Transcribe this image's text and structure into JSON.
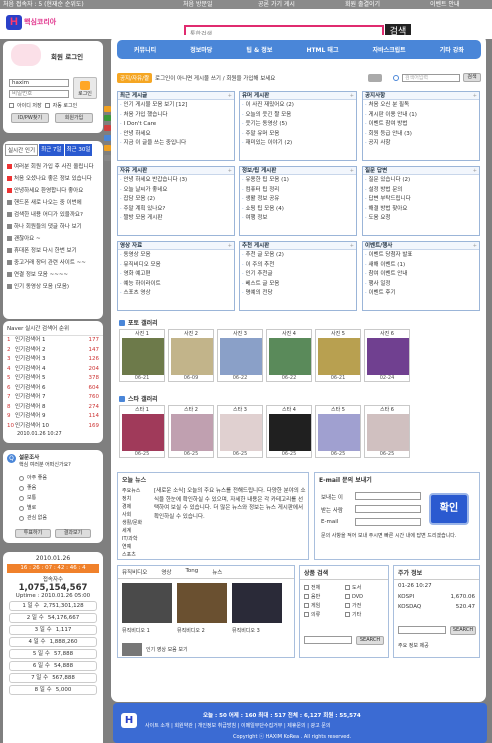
{
  "topbar": {
    "items": [
      "처음 접속자 : 5 (현재순 순위도)",
      "처음 방문일",
      "공론 가기 게시",
      "회원 출결이기",
      "이벤트 안내"
    ]
  },
  "header": {
    "logo": "핵심코리아",
    "search_placeholder": "통합검색",
    "search_button": "검색"
  },
  "login": {
    "title": "회원 로그인",
    "id_value": "haxim",
    "pw_placeholder": "비밀번호",
    "login_button": "로그인",
    "remember_id": "아이디 저장",
    "auto_login": "자동 로그인",
    "find_button": "ID/PW찾기",
    "join_button": "회원가입"
  },
  "ranking": {
    "tabs": [
      "실시간 인기",
      "최근 7일",
      "최근 30일"
    ],
    "items": [
      "여러분 회원 가입 후 사진 올립니다",
      "처음 오셨나요 좋은 정보 있습니다",
      "안녕하세요 환영합니다 좋아요",
      "핸드폰 새로 나오는 중 이번에",
      "검색한 내용 어디가 있을까요?",
      "하나 회원들의 댓글 하나 보기",
      "괜찮아요 ~",
      "휴대폰 정보 다시 한번 보기",
      "중고거래 장터 관련 사이트 ~~",
      "연결 정보 모음 ~~~~",
      "인기 동영상 모음 (모음)"
    ]
  },
  "rank_list": {
    "title": "Naver 실시간 검색어 순위",
    "items": [
      {
        "name": "인기검색어 1",
        "val": "177"
      },
      {
        "name": "인기검색어 2",
        "val": "147"
      },
      {
        "name": "인기검색어 3",
        "val": "126"
      },
      {
        "name": "인기검색어 4",
        "val": "204"
      },
      {
        "name": "인기검색어 5",
        "val": "378"
      },
      {
        "name": "인기검색어 6",
        "val": "604"
      },
      {
        "name": "인기검색어 7",
        "val": "760"
      },
      {
        "name": "인기검색어 8",
        "val": "274"
      },
      {
        "name": "인기검색어 9",
        "val": "114"
      },
      {
        "name": "인기검색어 10",
        "val": "169"
      }
    ],
    "date": "2010.01.26 10:27"
  },
  "poll": {
    "title": "설문조사",
    "question": "핵심 여러분 어떠신가요?",
    "options": [
      "아주 좋음",
      "좋음",
      "보통",
      "별로",
      "관심 없음"
    ],
    "vote": "투표하기",
    "result": "결과보기"
  },
  "visit": {
    "date": "2010.01.26",
    "time": "16 : 26 : 07 : 42 : 46 : 4",
    "count_label": "접속자수",
    "count": "1,075,154,567",
    "uptime": "2010.01.26 05:00",
    "rows": [
      {
        "l": "1 일 수",
        "v": "2,751,301,128"
      },
      {
        "l": "2 일 수",
        "v": "54,176,667"
      },
      {
        "l": "3 일 수",
        "v": "1,117"
      },
      {
        "l": "4 일 수",
        "v": "1,888,260"
      },
      {
        "l": "5 일 수",
        "v": "57,888"
      },
      {
        "l": "6 일 수",
        "v": "54,888"
      },
      {
        "l": "7 일 수",
        "v": "567,888"
      },
      {
        "l": "8 일 수",
        "v": "5,000"
      }
    ]
  },
  "nav": [
    "커뮤니티",
    "정보마당",
    "팁 & 정보",
    "HTML 태그",
    "자바스크립트",
    "기타 강좌"
  ],
  "sub": {
    "tag": "공지/자유/짤",
    "notice": "로그인이 아니면 게시물 쓰기 / 회원을 가입해 보세요",
    "search_placeholder": "검색어입력",
    "search_button": "검색"
  },
  "boards": [
    {
      "title": "최근 게시글",
      "items": [
        "인기 게시물 모음 보기 [12]",
        "처음 가입 했습니다",
        "I Don't Care",
        "안녕 하세요",
        "지금 이 글을 쓰는 중입니다"
      ]
    },
    {
      "title": "유머 게시판",
      "items": [
        "이 사진 재밌어요 (2)",
        "오늘의 웃긴 짤 모음",
        "웃기는 동영상 (5)",
        "주말 유머 모음",
        "재미있는 이야기 (2)"
      ]
    },
    {
      "title": "공지사항",
      "items": [
        "처음 오신 분 필독",
        "게시판 이용 안내 (1)",
        "이벤트 참여 방법",
        "회원 등급 안내 (3)",
        "공지 사항"
      ]
    },
    {
      "title": "자유 게시판",
      "items": [
        "안녕 하세요 반갑습니다 (3)",
        "오늘 날씨가 좋네요",
        "잡담 모음 (2)",
        "주말 계획 있나요?",
        "짤방 모음 게시판"
      ]
    },
    {
      "title": "정보/팁 게시판",
      "items": [
        "유용한 팁 모음 (1)",
        "컴퓨터 팁 정리",
        "생활 정보 공유",
        "쇼핑 팁 모음 (4)",
        "여행 정보"
      ]
    },
    {
      "title": "질문 답변",
      "items": [
        "질문 있습니다 (2)",
        "설정 방법 문의",
        "답변 부탁드립니다",
        "해결 방법 찾아요",
        "도움 요청"
      ]
    },
    {
      "title": "영상 자료",
      "items": [
        "동영상 모음",
        "뮤직비디오 모음",
        "영화 예고편",
        "예능 하이라이트",
        "스포츠 영상"
      ]
    },
    {
      "title": "추천 게시판",
      "items": [
        "추천 글 모음 (2)",
        "이 주의 추천",
        "인기 추천글",
        "베스트 글 모음",
        "명예의 전당"
      ]
    },
    {
      "title": "이벤트/행사",
      "items": [
        "이벤트 당첨자 발표",
        "새해 이벤트 (1)",
        "참여 이벤트 안내",
        "행사 일정",
        "이벤트 후기"
      ]
    }
  ],
  "photo_section": "포토 갤러리",
  "photos": [
    {
      "l": "사진 1",
      "d": "06-21"
    },
    {
      "l": "사진 2",
      "d": "06-09"
    },
    {
      "l": "사진 3",
      "d": "06-22"
    },
    {
      "l": "사진 4",
      "d": "06-22"
    },
    {
      "l": "사진 5",
      "d": "06-21"
    },
    {
      "l": "사진 6",
      "d": "02-24"
    }
  ],
  "star_section": "스타 갤러리",
  "stars": [
    {
      "l": "스타 1",
      "d": "06-25"
    },
    {
      "l": "스타 2",
      "d": "06-25"
    },
    {
      "l": "스타 3",
      "d": "06-25"
    },
    {
      "l": "스타 4",
      "d": "06-25"
    },
    {
      "l": "스타 5",
      "d": "06-25"
    },
    {
      "l": "스타 6",
      "d": "06-25"
    }
  ],
  "news": {
    "title": "오늘 뉴스",
    "cats": [
      "주요뉴스",
      "정치",
      "경제",
      "사회",
      "생활/문화",
      "세계",
      "IT/과학",
      "연예",
      "스포츠"
    ],
    "text": "[새로운 소식] 오늘의 주요 뉴스를 전해드립니다. 다양한 분야의 소식을 한눈에 확인하실 수 있으며, 자세한 내용은 각 카테고리를 선택하여 보실 수 있습니다. 더 많은 뉴스와 정보는 뉴스 게시판에서 확인하실 수 있습니다."
  },
  "email": {
    "title": "E-mail 문의 보내기",
    "name_label": "보내는 이",
    "to_label": "받는 사람",
    "mail_label": "E-mail",
    "confirm": "확인",
    "note": "문의 사항을 적어 보내 주시면 빠른 시간 내에 답변 드리겠습니다."
  },
  "media": {
    "tabs": [
      "뮤직비디오",
      "영상",
      "Tong",
      "뉴스"
    ],
    "items": [
      "뮤직비디오 1",
      "뮤직비디오 2",
      "뮤직비디오 3"
    ],
    "caption": "인기 영상 모음 보기"
  },
  "shop": {
    "title": "상품 검색",
    "opts": [
      "전체",
      "도서",
      "음반",
      "DVD",
      "게임",
      "가전",
      "의류",
      "기타"
    ],
    "placeholder": "",
    "btn": "SEARCH"
  },
  "stock": {
    "title": "주가 정보",
    "date": "01-26 10:27",
    "kospi_label": "KOSPI",
    "kospi": "1,670.06",
    "kosdaq_label": "KOSDAQ",
    "kosdaq": "520.47",
    "btn": "SEARCH",
    "note": "주요 정보 제공"
  },
  "footer": {
    "stats": "오늘 : 50  어제 : 160  최대 : 517  전체 : 6,127  회원 : 55,574",
    "links": "사이트 소개 | 회원약관 | 개인정보 취급방침 | 이메일무단수집거부 | 제휴문의 | 광고 문의",
    "copy": "Copyright ⓒ HAXIM KoRea . All rights reserved."
  }
}
